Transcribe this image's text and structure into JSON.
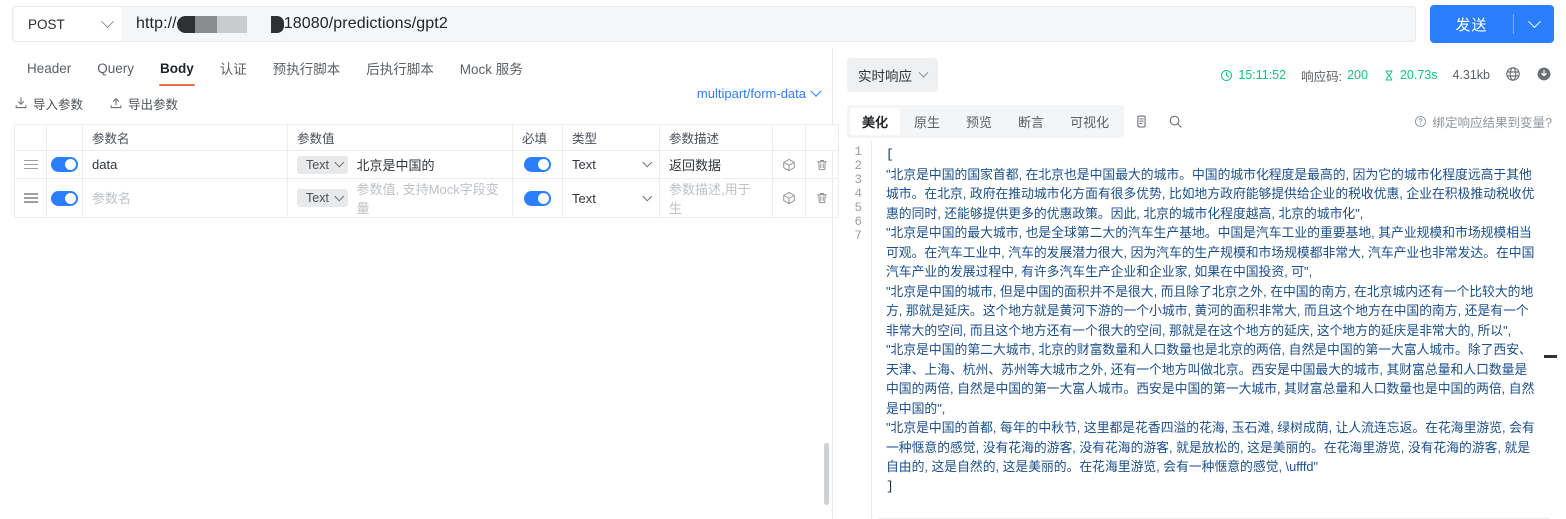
{
  "urlbar": {
    "method": "POST",
    "url_prefix": "http://",
    "url_suffix": "18080/predictions/gpt2",
    "send_label": "发送"
  },
  "request": {
    "tabs": [
      {
        "label": "Header",
        "active": false
      },
      {
        "label": "Query",
        "active": false
      },
      {
        "label": "Body",
        "active": true
      },
      {
        "label": "认证",
        "active": false
      },
      {
        "label": "预执行脚本",
        "active": false
      },
      {
        "label": "后执行脚本",
        "active": false
      },
      {
        "label": "Mock 服务",
        "active": false
      }
    ],
    "import_label": "导入参数",
    "export_label": "导出参数",
    "content_type": "multipart/form-data",
    "table": {
      "headers": [
        "",
        "",
        "参数名",
        "参数值",
        "必填",
        "类型",
        "参数描述",
        "",
        ""
      ],
      "rows": [
        {
          "enabled": true,
          "name": "data",
          "name_placeholder": "参数名",
          "value_type": "Text",
          "value": "北京是中国的",
          "value_placeholder": "参数值, 支持Mock字段变量",
          "required": true,
          "type": "Text",
          "desc": "返回数据",
          "desc_placeholder": "参数描述,用于生"
        },
        {
          "enabled": true,
          "name": "",
          "name_placeholder": "参数名",
          "value_type": "Text",
          "value": "",
          "value_placeholder": "参数值, 支持Mock字段变量",
          "required": true,
          "type": "Text",
          "desc": "",
          "desc_placeholder": "参数描述,用于生"
        }
      ]
    }
  },
  "response": {
    "mode_label": "实时响应",
    "time": "15:11:52",
    "status_label": "响应码:",
    "status_code": "200",
    "duration": "20.73s",
    "size": "4.31kb",
    "tabs": [
      {
        "label": "美化",
        "active": true
      },
      {
        "label": "原生",
        "active": false
      },
      {
        "label": "预览",
        "active": false
      },
      {
        "label": "断言",
        "active": false
      },
      {
        "label": "可视化",
        "active": false
      }
    ],
    "bind_label": "绑定响应结果到变量?",
    "colors": {
      "accent_blue": "#2b7fff",
      "status_green": "#17c07e",
      "tab_underline": "#e8734a",
      "json_string": "#1b4f8a"
    },
    "code_lines": [
      {
        "n": "1",
        "kind": "bracket",
        "text": "["
      },
      {
        "n": "2",
        "kind": "string",
        "text": "\"北京是中国的国家首都, 在北京也是中国最大的城市。中国的城市化程度是最高的, 因为它的城市化程度远高于其他城市。在北京, 政府在推动城市化方面有很多优势, 比如地方政府能够提供给企业的税收优惠, 企业在积极推动税收优惠的同时, 还能够提供更多的优惠政策。因此, 北京的城市化程度越高, 北京的城市化\","
      },
      {
        "n": "3",
        "kind": "string",
        "text": "\"北京是中国的最大城市, 也是全球第二大的汽车生产基地。中国是汽车工业的重要基地, 其产业规模和市场规模相当可观。在汽车工业中, 汽车的发展潜力很大, 因为汽车的生产规模和市场规模都非常大, 汽车产业也非常发达。在中国汽车产业的发展过程中, 有许多汽车生产企业和企业家, 如果在中国投资, 可\","
      },
      {
        "n": "4",
        "kind": "string",
        "text": "\"北京是中国的城市, 但是中国的面积并不是很大, 而且除了北京之外, 在中国的南方, 在北京城内还有一个比较大的地方, 那就是延庆。这个地方就是黄河下游的一个小城市, 黄河的面积非常大, 而且这个地方在中国的南方, 还是有一个非常大的空间, 而且这个地方还有一个很大的空间, 那就是在这个地方的延庆, 这个地方的延庆是非常大的, 所以\","
      },
      {
        "n": "5",
        "kind": "string",
        "text": "\"北京是中国的第二大城市, 北京的财富数量和人口数量也是北京的两倍, 自然是中国的第一大富人城市。除了西安、天津、上海、杭州、苏州等大城市之外, 还有一个地方叫做北京。西安是中国最大的城市, 其财富总量和人口数量是中国的两倍, 自然是中国的第一大富人城市。西安是中国的第一大城市, 其财富总量和人口数量也是中国的两倍, 自然是中国的\","
      },
      {
        "n": "6",
        "kind": "string",
        "text": "\"北京是中国的首都, 每年的中秋节, 这里都是花香四溢的花海, 玉石滩, 绿树成荫, 让人流连忘返。在花海里游览, 会有一种惬意的感觉, 没有花海的游客, 没有花海的游客, 就是放松的, 这是美丽的。在花海里游览, 没有花海的游客, 就是自由的, 这是自然的, 这是美丽的。在花海里游览, 会有一种惬意的感觉, \\ufffd\""
      },
      {
        "n": "7",
        "kind": "bracket",
        "text": "]"
      }
    ]
  }
}
